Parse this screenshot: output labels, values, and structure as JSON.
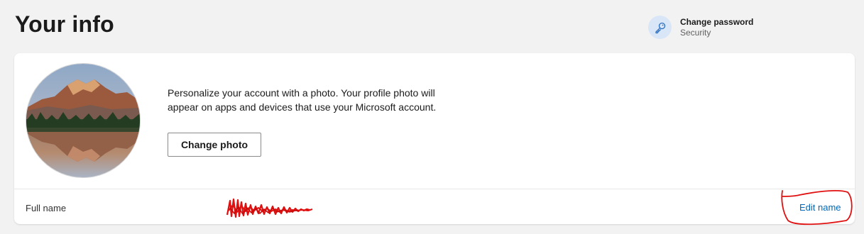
{
  "header": {
    "title": "Your info",
    "change_password": {
      "title": "Change password",
      "subtitle": "Security",
      "icon": "key-icon"
    }
  },
  "profile_card": {
    "description": "Personalize your account with a photo. Your profile photo will appear on apps and devices that use your Microsoft account.",
    "change_photo_label": "Change photo",
    "avatar": "mountain-lake-photo"
  },
  "name_row": {
    "label": "Full name",
    "value_redacted": true,
    "edit_label": "Edit name"
  },
  "colors": {
    "page_bg": "#f2f2f2",
    "card_bg": "#ffffff",
    "link": "#0067b8",
    "annotation_red": "#e01010"
  }
}
